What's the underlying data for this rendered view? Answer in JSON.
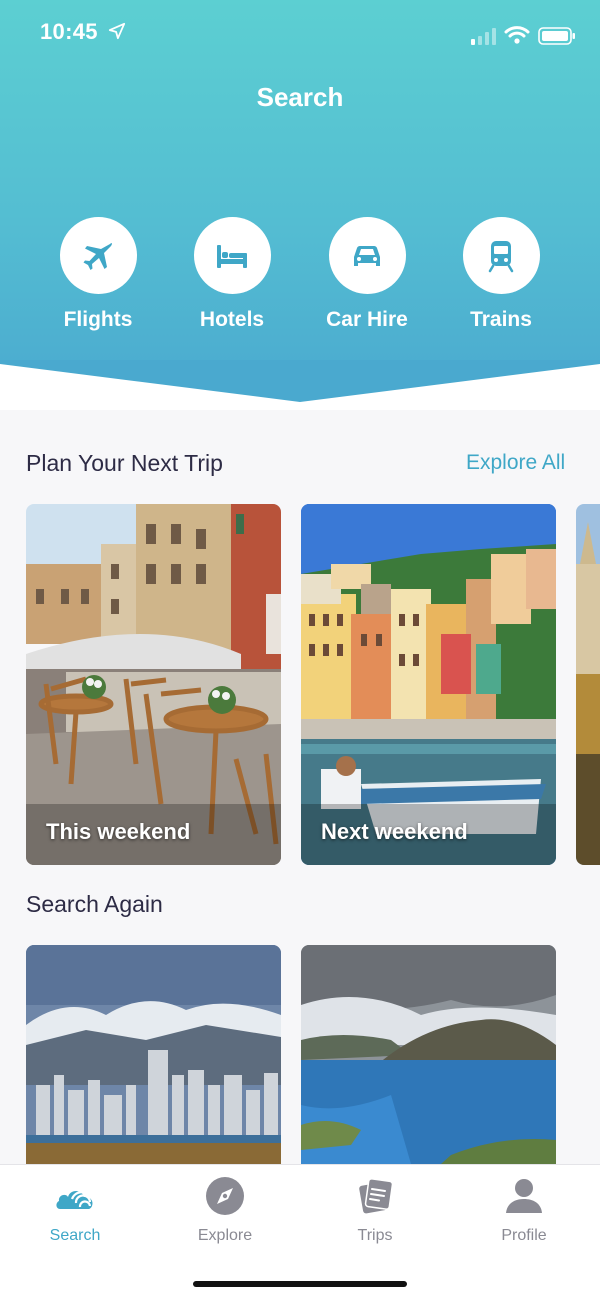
{
  "status_bar": {
    "time": "10:45"
  },
  "header": {
    "title": "Search"
  },
  "categories": [
    {
      "label": "Flights",
      "icon": "airplane-icon"
    },
    {
      "label": "Hotels",
      "icon": "bed-icon"
    },
    {
      "label": "Car Hire",
      "icon": "car-icon"
    },
    {
      "label": "Trains",
      "icon": "train-icon"
    }
  ],
  "plan_section": {
    "title": "Plan Your Next Trip",
    "explore_all": "Explore All",
    "cards": [
      {
        "label": "This weekend"
      },
      {
        "label": "Next weekend"
      }
    ]
  },
  "search_again": {
    "title": "Search Again"
  },
  "tabbar": {
    "tabs": [
      {
        "label": "Search",
        "icon": "search-cloud-icon",
        "active": true
      },
      {
        "label": "Explore",
        "icon": "compass-icon",
        "active": false
      },
      {
        "label": "Trips",
        "icon": "trips-icon",
        "active": false
      },
      {
        "label": "Profile",
        "icon": "profile-icon",
        "active": false
      }
    ]
  },
  "colors": {
    "accent": "#3fa7c7",
    "header_top": "#5ccfd2",
    "header_bottom": "#4aa9cf",
    "title_text": "#2d2b45"
  }
}
